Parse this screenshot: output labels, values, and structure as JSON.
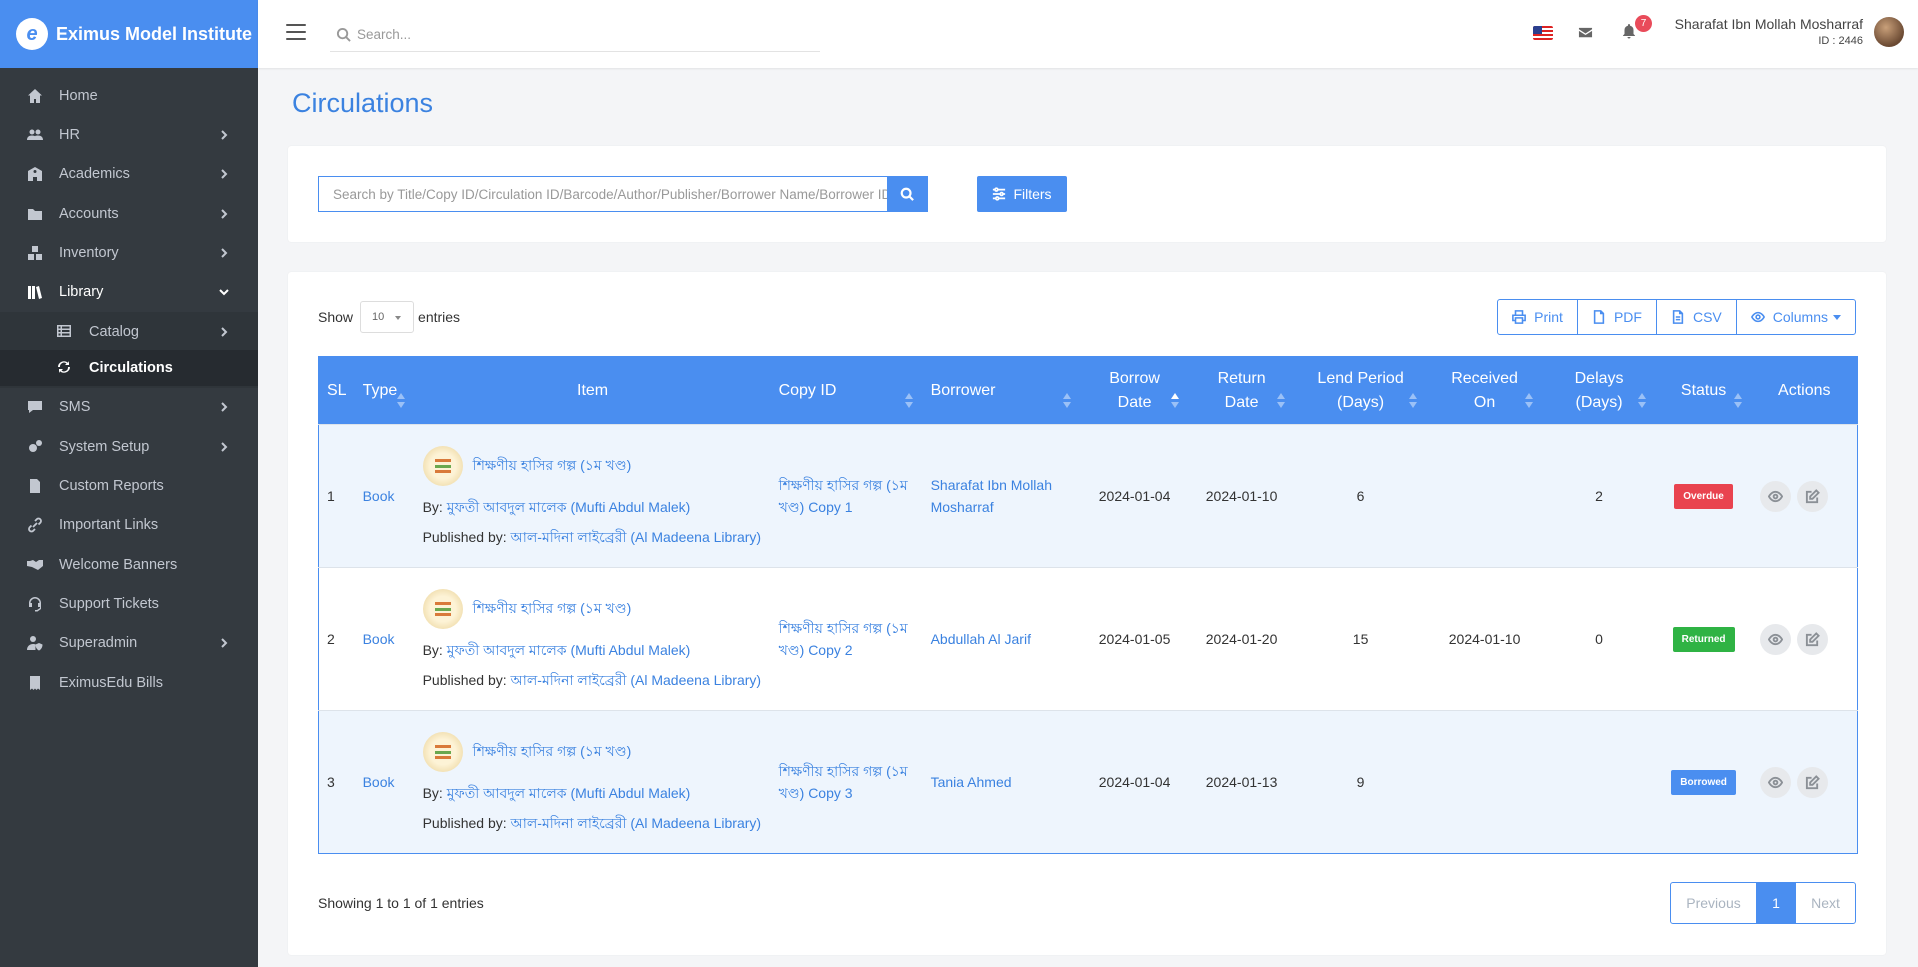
{
  "brand": {
    "name": "Eximus Model Institute"
  },
  "header": {
    "search_placeholder": "Search...",
    "notification_count": "7",
    "user_name": "Sharafat Ibn Mollah Mosharraf",
    "user_id": "ID : 2446"
  },
  "sidebar": {
    "items": [
      {
        "label": "Home",
        "icon": "home-icon"
      },
      {
        "label": "HR",
        "icon": "users-icon",
        "has_children": true
      },
      {
        "label": "Academics",
        "icon": "school-icon",
        "has_children": true
      },
      {
        "label": "Accounts",
        "icon": "folder-icon",
        "has_children": true
      },
      {
        "label": "Inventory",
        "icon": "boxes-icon",
        "has_children": true
      },
      {
        "label": "Library",
        "icon": "library-icon",
        "expanded": true
      },
      {
        "label": "SMS",
        "icon": "chat-icon",
        "has_children": true
      },
      {
        "label": "System Setup",
        "icon": "cogs-icon",
        "has_children": true
      },
      {
        "label": "Custom Reports",
        "icon": "file-icon"
      },
      {
        "label": "Important Links",
        "icon": "link-icon"
      },
      {
        "label": "Welcome Banners",
        "icon": "handshake-icon"
      },
      {
        "label": "Support Tickets",
        "icon": "headset-icon"
      },
      {
        "label": "Superadmin",
        "icon": "user-shield-icon",
        "has_children": true
      },
      {
        "label": "EximusEdu Bills",
        "icon": "bill-icon"
      }
    ],
    "library_sub": [
      {
        "label": "Catalog",
        "icon": "list-icon"
      },
      {
        "label": "Circulations",
        "icon": "sync-icon",
        "active": true
      }
    ]
  },
  "page": {
    "title": "Circulations",
    "search_placeholder": "Search by Title/Copy ID/Circulation ID/Barcode/Author/Publisher/Borrower Name/Borrower ID",
    "filters_label": "Filters",
    "show_label": "Show",
    "entries_value": "10",
    "entries_label": "entries",
    "export": {
      "print": "Print",
      "pdf": "PDF",
      "csv": "CSV",
      "columns": "Columns"
    },
    "showing_text": "Showing 1 to 1 of 1 entries",
    "pagination": {
      "previous": "Previous",
      "current": "1",
      "next": "Next"
    }
  },
  "table": {
    "columns": {
      "sl": "SL",
      "type": "Type",
      "item": "Item",
      "copy_id": "Copy ID",
      "borrower": "Borrower",
      "borrow_date_1": "Borrow",
      "borrow_date_2": "Date",
      "return_date_1": "Return",
      "return_date_2": "Date",
      "lend_period_1": "Lend Period",
      "lend_period_2": "(Days)",
      "received_on_1": "Received",
      "received_on_2": "On",
      "delays_1": "Delays",
      "delays_2": "(Days)",
      "status": "Status",
      "actions": "Actions"
    },
    "by_label": "By:",
    "published_label": "Published by:",
    "rows": [
      {
        "sl": "1",
        "type": "Book",
        "title": "শিক্ষণীয় হাসির গল্প (১ম খণ্ড)",
        "author": "মুফতী আবদুল মালেক (Mufti Abdul Malek)",
        "publisher": "আল-মদিনা লাইব্রেরী (Al Madeena Library)",
        "copy_id": "শিক্ষণীয় হাসির গল্প (১ম খণ্ড) Copy 1",
        "borrower": "Sharafat Ibn Mollah Mosharraf",
        "borrow_date": "2024-01-04",
        "return_date": "2024-01-10",
        "lend_period": "6",
        "received_on": "",
        "delays": "2",
        "status": "Overdue",
        "status_color": "#e9434f"
      },
      {
        "sl": "2",
        "type": "Book",
        "title": "শিক্ষণীয় হাসির গল্প (১ম খণ্ড)",
        "author": "মুফতী আবদুল মালেক (Mufti Abdul Malek)",
        "publisher": "আল-মদিনা লাইব্রেরী (Al Madeena Library)",
        "copy_id": "শিক্ষণীয় হাসির গল্প (১ম খণ্ড) Copy 2",
        "borrower": "Abdullah Al Jarif",
        "borrow_date": "2024-01-05",
        "return_date": "2024-01-20",
        "lend_period": "15",
        "received_on": "2024-01-10",
        "delays": "0",
        "status": "Returned",
        "status_color": "#2fb344"
      },
      {
        "sl": "3",
        "type": "Book",
        "title": "শিক্ষণীয় হাসির গল্প (১ম খণ্ড)",
        "author": "মুফতী আবদুল মালেক (Mufti Abdul Malek)",
        "publisher": "আল-মদিনা লাইব্রেরী (Al Madeena Library)",
        "copy_id": "শিক্ষণীয় হাসির গল্প (১ম খণ্ড) Copy 3",
        "borrower": "Tania Ahmed",
        "borrow_date": "2024-01-04",
        "return_date": "2024-01-13",
        "lend_period": "9",
        "received_on": "",
        "delays": "",
        "status": "Borrowed",
        "status_color": "#4a8ef0"
      }
    ]
  },
  "colors": {
    "accent": "#4a8ef0",
    "sidebar_bg": "#343a40",
    "title": "#3b82e0"
  }
}
